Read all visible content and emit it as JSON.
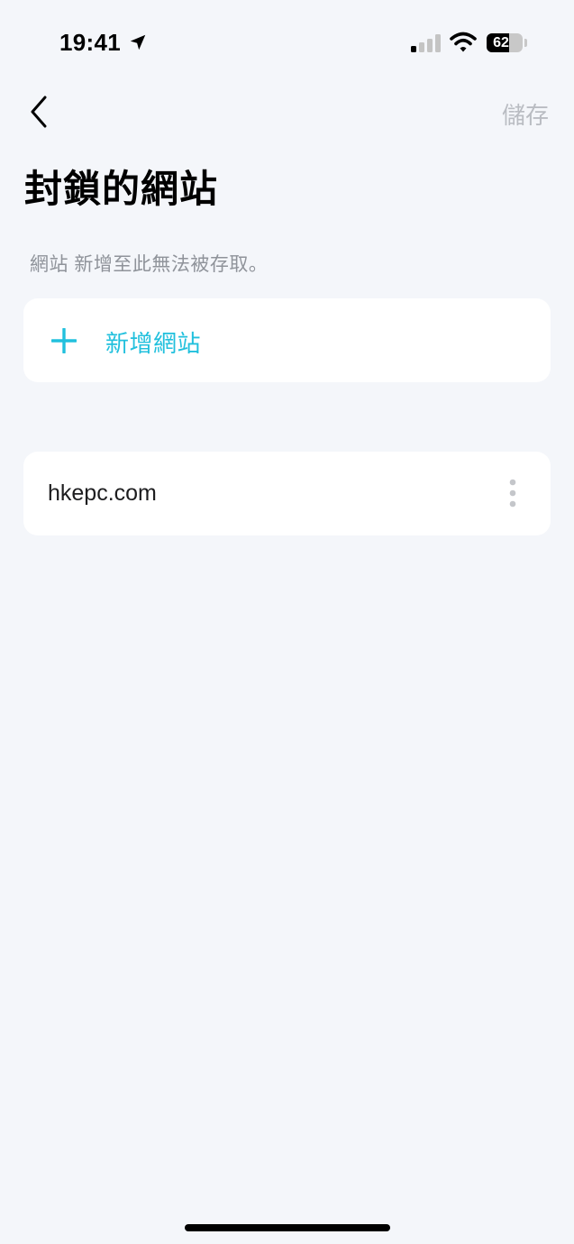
{
  "status_bar": {
    "time": "19:41",
    "battery": "62",
    "battery_level": 0.62,
    "icons": [
      "location-arrow-icon",
      "cellular-signal-icon",
      "wifi-icon",
      "battery-icon"
    ]
  },
  "nav": {
    "back_icon": "chevron-left-icon",
    "save_label": "儲存"
  },
  "page": {
    "title": "封鎖的網站",
    "description": "網站 新增至此無法被存取。"
  },
  "add_site": {
    "icon": "plus-icon",
    "label": "新增網站"
  },
  "sites": [
    {
      "domain": "hkepc.com",
      "menu_icon": "more-vertical-icon"
    }
  ],
  "colors": {
    "accent": "#21c0dd",
    "background": "#f4f6fa",
    "card": "#ffffff",
    "muted_text": "#8f939a",
    "disabled_text": "#b9bcc2"
  }
}
